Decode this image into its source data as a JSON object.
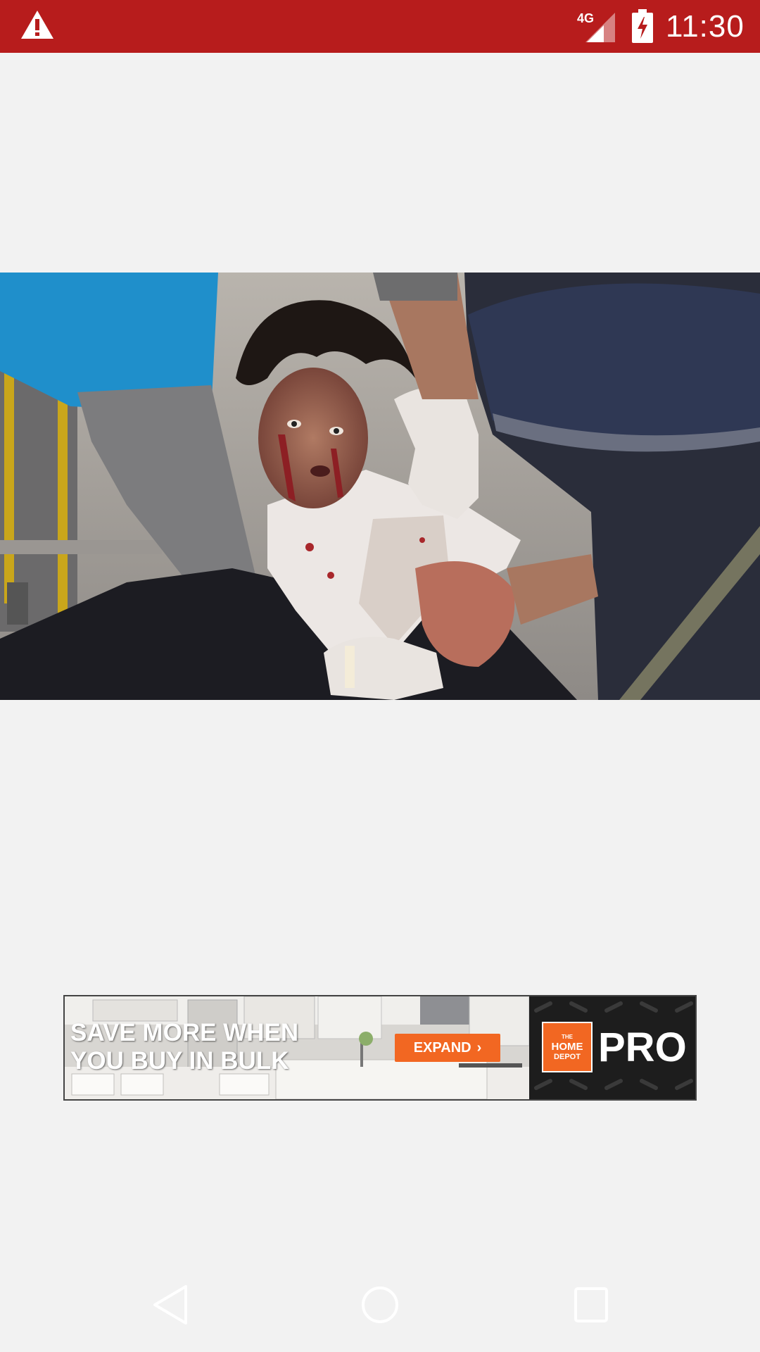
{
  "status_bar": {
    "network": "4G",
    "time": "11:30",
    "background_color": "#b71c1c",
    "icons": [
      "warning-icon",
      "signal-icon",
      "battery-charging-icon"
    ]
  },
  "article_photo": {
    "description_icon": "news-photo"
  },
  "ad": {
    "headline_line1": "SAVE MORE WHEN",
    "headline_line2": "YOU BUY IN BULK",
    "expand_label": "EXPAND",
    "logo_line1": "THE",
    "logo_line2": "HOME",
    "logo_line3": "DEPOT",
    "pro_label": "PRO",
    "accent_color": "#f26722"
  },
  "nav_bar": {
    "icons": [
      "back-icon",
      "home-icon",
      "recents-icon"
    ]
  }
}
